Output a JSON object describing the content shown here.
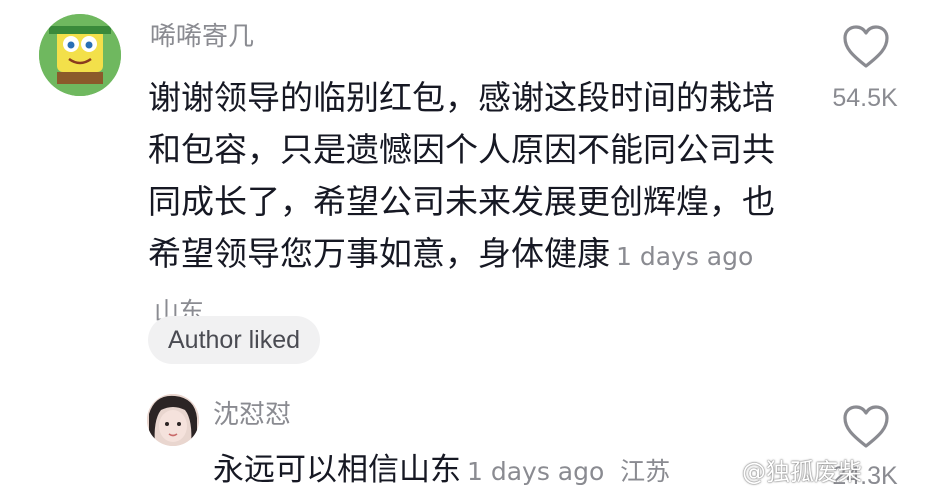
{
  "comment": {
    "username": "唏唏寄几",
    "text": "谢谢领导的临别红包，感谢这段时间的栽培和包容，只是遗憾因个人原因不能同公司共同成长了，希望公司未来发展更创辉煌，也希望领导您万事如意，身体健康",
    "time": "1 days ago",
    "location": "山东",
    "like_count": "54.5K",
    "author_liked": "Author liked",
    "avatar_icon": "spongebob-avatar"
  },
  "reply": {
    "username": "沈怼怼",
    "text": "永远可以相信山东",
    "time": "1 days ago",
    "location": "江苏",
    "like_count": "24.3K",
    "avatar_icon": "girl-avatar"
  },
  "watermark": "@独孤废柴",
  "colors": {
    "text": "#161823",
    "muted": "#8a8b91",
    "badge_bg": "#f1f1f2"
  }
}
